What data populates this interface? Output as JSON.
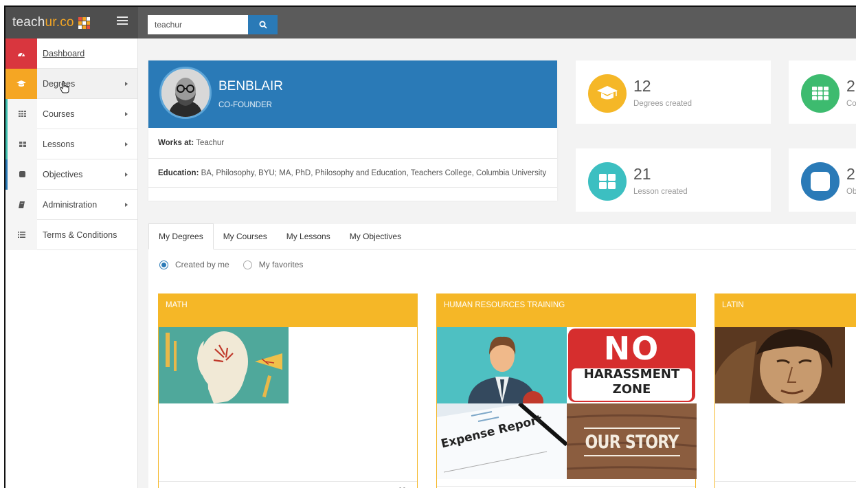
{
  "app": {
    "brand_prefix": "teach",
    "brand_accent": "ur.co",
    "search_value": "teachur"
  },
  "sidebar": {
    "items": [
      {
        "label": "Dashboard"
      },
      {
        "label": "Degrees"
      },
      {
        "label": "Courses"
      },
      {
        "label": "Lessons"
      },
      {
        "label": "Objectives"
      },
      {
        "label": "Administration"
      },
      {
        "label": "Terms & Conditions"
      }
    ]
  },
  "profile": {
    "name": "BENBLAIR",
    "role": "CO-FOUNDER",
    "works_at_label": "Works at:",
    "works_at_value": "Teachur",
    "education_label": "Education:",
    "education_value": "BA, Philosophy, BYU; MA, PhD, Philosophy and Education, Teachers College, Columbia University"
  },
  "stats": [
    {
      "value": "12",
      "label": "Degrees created",
      "color": "#f5b727",
      "icon": "graduation-cap-icon"
    },
    {
      "value": "2",
      "label": "Co",
      "color": "#3dbb6f",
      "icon": "grid-icon"
    },
    {
      "value": "21",
      "label": "Lesson created",
      "color": "#3cbfc1",
      "icon": "blocks-icon"
    },
    {
      "value": "2",
      "label": "Ob",
      "color": "#2a7ab7",
      "icon": "square-icon"
    }
  ],
  "tabs": [
    "My Degrees",
    "My Courses",
    "My Lessons",
    "My Objectives"
  ],
  "filters": {
    "created": "Created by me",
    "favorites": "My favorites"
  },
  "degree_cards": [
    {
      "title": "MATH"
    },
    {
      "title": "HUMAN RESOURCES TRAINING",
      "tile_texts": {
        "no": "NO",
        "harassment": "HARASSMENT",
        "zone": "ZONE",
        "expense": "Expense Report",
        "story": "OUR STORY"
      }
    },
    {
      "title": "LATIN"
    }
  ],
  "colors": {
    "accent_blue": "#2a7ab7",
    "accent_orange": "#f5a623",
    "accent_red": "#d9363e",
    "card_yellow": "#f5b727"
  }
}
